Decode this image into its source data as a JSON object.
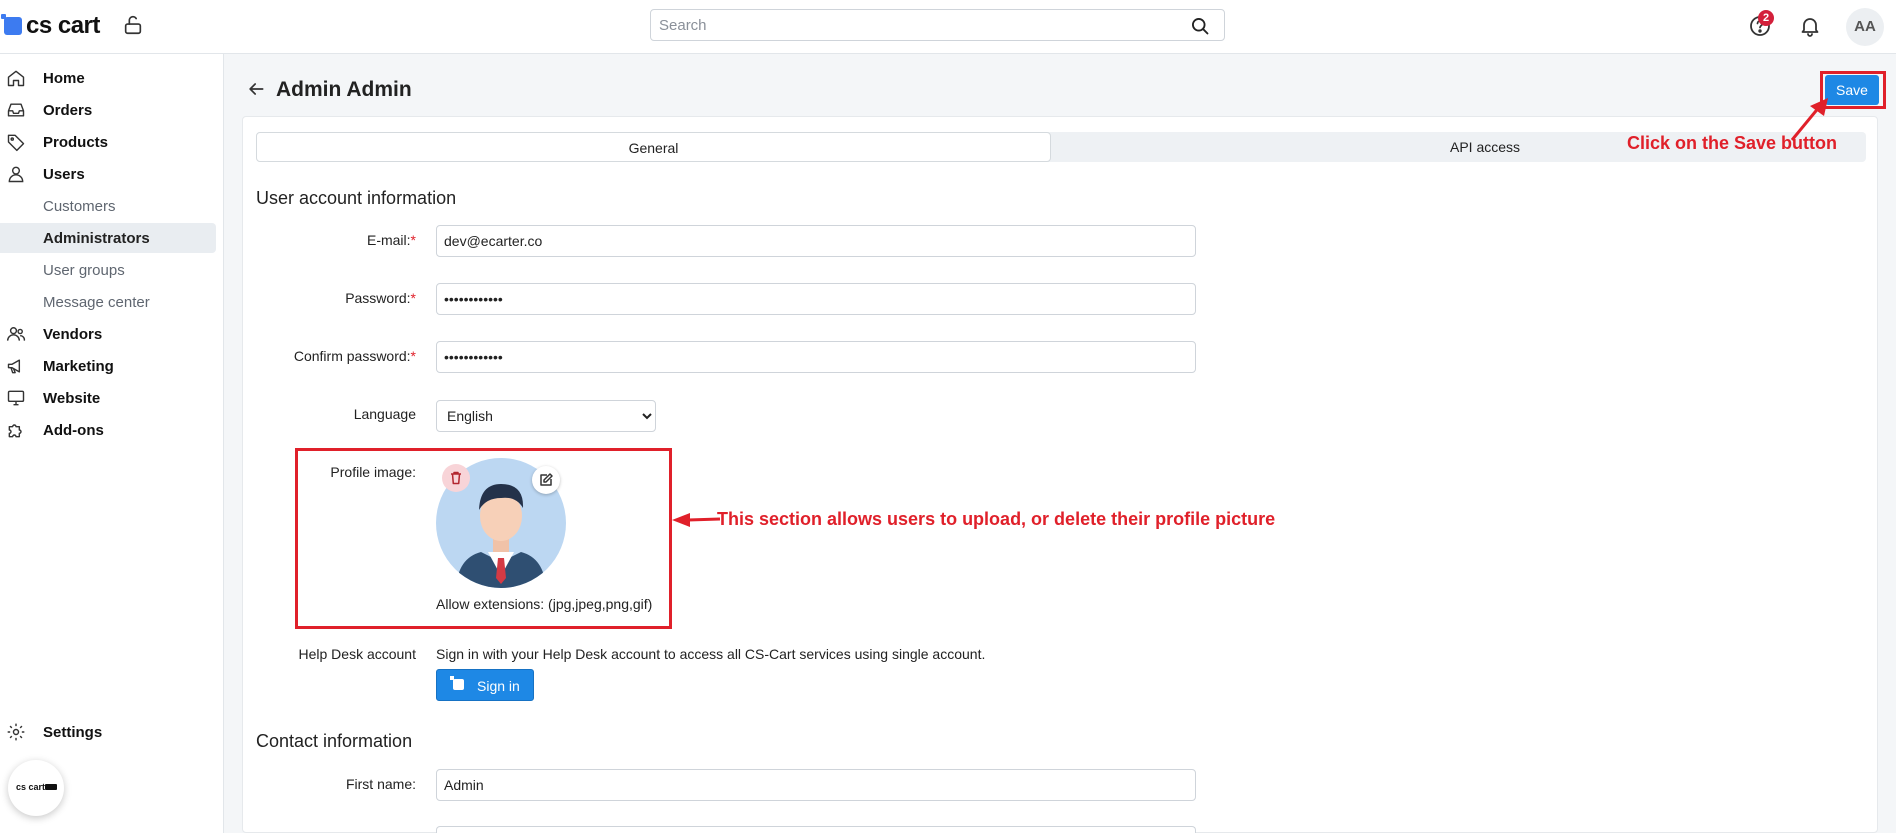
{
  "app": {
    "logo_text": "cs cart",
    "mini_logo_text": "cs cart"
  },
  "header": {
    "search_placeholder": "Search",
    "notifications_badge": "2",
    "avatar_initials": "AA"
  },
  "sidebar": {
    "items": [
      {
        "label": "Home",
        "icon": "home-icon"
      },
      {
        "label": "Orders",
        "icon": "inbox-icon"
      },
      {
        "label": "Products",
        "icon": "tag-icon"
      },
      {
        "label": "Users",
        "icon": "user-icon"
      },
      {
        "label": "Customers"
      },
      {
        "label": "Administrators"
      },
      {
        "label": "User groups"
      },
      {
        "label": "Message center"
      },
      {
        "label": "Vendors",
        "icon": "vendors-icon"
      },
      {
        "label": "Marketing",
        "icon": "megaphone-icon"
      },
      {
        "label": "Website",
        "icon": "monitor-icon"
      },
      {
        "label": "Add-ons",
        "icon": "puzzle-icon"
      }
    ],
    "settings_label": "Settings"
  },
  "page": {
    "title": "Admin Admin",
    "save_label": "Save"
  },
  "tabs": [
    {
      "label": "General"
    },
    {
      "label": "API access"
    }
  ],
  "account": {
    "section_title": "User account information",
    "email_label": "E-mail:",
    "email_value": "dev@ecarter.co",
    "password_label": "Password:",
    "password_value": "••••••••••••",
    "confirm_label": "Confirm password:",
    "confirm_value": "••••••••••••",
    "language_label": "Language",
    "language_value": "English",
    "profile_label": "Profile image:",
    "extensions_text": "Allow extensions: (jpg,jpeg,png,gif)",
    "helpdesk_label": "Help Desk account",
    "helpdesk_text": "Sign in with your Help Desk account to access all CS-Cart services using single account.",
    "signin_label": "Sign in"
  },
  "contact": {
    "section_title": "Contact information",
    "first_name_label": "First name:",
    "first_name_value": "Admin"
  },
  "annotations": {
    "save_callout": "Click on the Save button",
    "profile_callout": "This section allows users to upload, or delete their profile picture",
    "color": "#e0202a"
  }
}
